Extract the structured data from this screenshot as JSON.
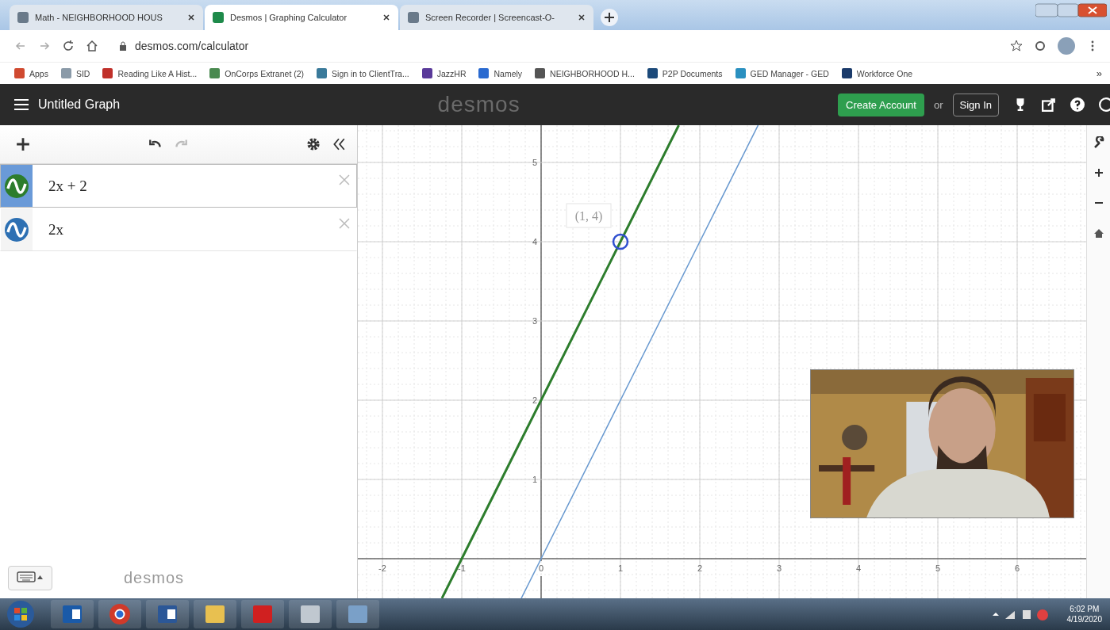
{
  "browser": {
    "tabs": [
      {
        "title": "Math - NEIGHBORHOOD HOUS",
        "selected": false
      },
      {
        "title": "Desmos | Graphing Calculator",
        "selected": true
      },
      {
        "title": "Screen Recorder | Screencast-O-",
        "selected": false
      }
    ],
    "address": "desmos.com/calculator",
    "bookmarks": [
      {
        "label": "Apps",
        "color": "#d04a30"
      },
      {
        "label": "SID",
        "color": "#8a9aa8"
      },
      {
        "label": "Reading Like A Hist...",
        "color": "#c0302a"
      },
      {
        "label": "OnCorps Extranet (2)",
        "color": "#4a8a50"
      },
      {
        "label": "Sign in to ClientTra...",
        "color": "#3a7a9a"
      },
      {
        "label": "JazzHR",
        "color": "#5a3a9a"
      },
      {
        "label": "Namely",
        "color": "#2a6ad0"
      },
      {
        "label": "NEIGHBORHOOD H...",
        "color": "#555555"
      },
      {
        "label": "P2P Documents",
        "color": "#1c4a7a"
      },
      {
        "label": "GED Manager - GED",
        "color": "#2a90c0"
      },
      {
        "label": "Workforce One",
        "color": "#1a3a6a"
      }
    ],
    "more": "»"
  },
  "header": {
    "title": "Untitled Graph",
    "logo": "desmos",
    "create_account": "Create Account",
    "or": "or",
    "sign_in": "Sign In"
  },
  "expressions": [
    {
      "latex": "2x + 2",
      "color": "#2d7d2d",
      "selected": true
    },
    {
      "latex": "2x",
      "color": "#2d70b3",
      "selected": false
    }
  ],
  "panel_logo": "desmos",
  "graph": {
    "chart_data": {
      "type": "line",
      "x": [
        -1.25,
        -1,
        -0.25,
        0,
        1,
        1.735,
        2,
        2.735
      ],
      "series": [
        {
          "color": "#2d7d2d",
          "values": [
            -0.5,
            0,
            1.5,
            2,
            4,
            5.47,
            null,
            null
          ]
        },
        {
          "color": "#6a9ad0",
          "values": [
            null,
            null,
            -0.5,
            0,
            2,
            3.47,
            4,
            5.47
          ]
        }
      ],
      "xlim": [
        -2.31,
        6.87
      ],
      "ylim": [
        -0.5,
        5.47
      ],
      "grid": true,
      "xticks": [
        -2,
        -1,
        0,
        1,
        2,
        3,
        4,
        5,
        6
      ],
      "yticks": [
        1,
        2,
        3,
        4,
        5
      ],
      "annotations": [
        {
          "x": 1,
          "y": 4,
          "text": "(1, 4)"
        }
      ]
    }
  },
  "taskbar": {
    "apps": [
      {
        "kind": "mail"
      },
      {
        "kind": "chrome"
      },
      {
        "kind": "word"
      },
      {
        "kind": "folder"
      },
      {
        "kind": "pdf"
      },
      {
        "kind": "snip"
      },
      {
        "kind": "paint"
      }
    ],
    "time": "6:02 PM",
    "date": "4/19/2020"
  }
}
